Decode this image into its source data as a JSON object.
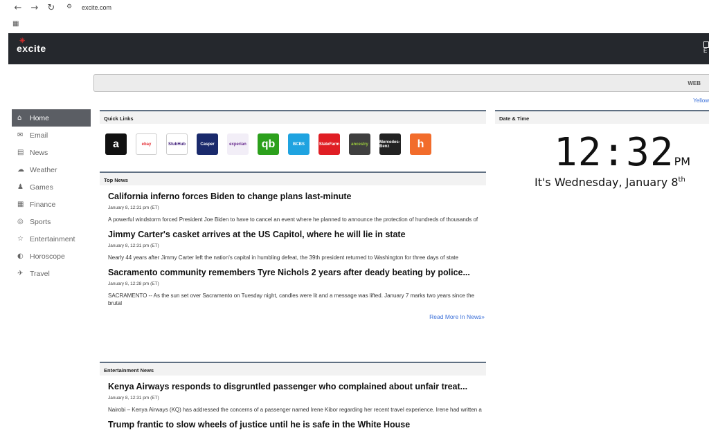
{
  "browser": {
    "url": "excite.com"
  },
  "header": {
    "logo_text": "excite",
    "right_label": "E"
  },
  "search": {
    "web_label": "WEB",
    "yellow_link": "Yellow"
  },
  "sidebar": {
    "items": [
      {
        "label": "Home",
        "icon": "home-icon",
        "glyph": "⌂",
        "active": true
      },
      {
        "label": "Email",
        "icon": "email-icon",
        "glyph": "✉",
        "active": false
      },
      {
        "label": "News",
        "icon": "news-icon",
        "glyph": "▤",
        "active": false
      },
      {
        "label": "Weather",
        "icon": "weather-icon",
        "glyph": "☁",
        "active": false
      },
      {
        "label": "Games",
        "icon": "games-icon",
        "glyph": "♟",
        "active": false
      },
      {
        "label": "Finance",
        "icon": "finance-icon",
        "glyph": "▦",
        "active": false
      },
      {
        "label": "Sports",
        "icon": "sports-icon",
        "glyph": "◎",
        "active": false
      },
      {
        "label": "Entertainment",
        "icon": "entertainment-icon",
        "glyph": "☆",
        "active": false
      },
      {
        "label": "Horoscope",
        "icon": "horoscope-icon",
        "glyph": "◐",
        "active": false
      },
      {
        "label": "Travel",
        "icon": "travel-icon",
        "glyph": "✈",
        "active": false
      }
    ]
  },
  "quick_links": {
    "title": "Quick Links",
    "logos": [
      {
        "name": "amazon",
        "text": "a",
        "bg": "#111111",
        "fg": "#ffffff"
      },
      {
        "name": "ebay",
        "text": "ebay",
        "bg": "#ffffff",
        "fg": "#e53238"
      },
      {
        "name": "stubhub",
        "text": "StubHub",
        "bg": "#ffffff",
        "fg": "#3d1a78"
      },
      {
        "name": "casper",
        "text": "Casper",
        "bg": "#1a2a6c",
        "fg": "#ffffff"
      },
      {
        "name": "experian",
        "text": "experian",
        "bg": "#f2eef7",
        "fg": "#6a2d8f"
      },
      {
        "name": "quickbooks",
        "text": "qb",
        "bg": "#2ca01c",
        "fg": "#ffffff"
      },
      {
        "name": "bluecross",
        "text": "BCBS",
        "bg": "#1fa3e0",
        "fg": "#ffffff"
      },
      {
        "name": "statefarm",
        "text": "StateFarm",
        "bg": "#e01e24",
        "fg": "#ffffff"
      },
      {
        "name": "ancestry",
        "text": "ancestry",
        "bg": "#3f3f3f",
        "fg": "#9ccc3c"
      },
      {
        "name": "mercedes",
        "text": "Mercedes-Benz",
        "bg": "#222222",
        "fg": "#ffffff"
      },
      {
        "name": "honey",
        "text": "h",
        "bg": "#f26c2b",
        "fg": "#ffffff"
      }
    ]
  },
  "top_news": {
    "title": "Top News",
    "articles": [
      {
        "headline": "California inferno forces Biden to change plans last-minute",
        "date": "January 8, 12:31 pm (ET)",
        "summary": "A powerful windstorm forced President Joe Biden to have to cancel an event where he planned to announce the protection of hundreds of thousands of"
      },
      {
        "headline": "Jimmy Carter's casket arrives at the US Capitol, where he will lie in state",
        "date": "January 8, 12:31 pm (ET)",
        "summary": "Nearly 44 years after Jimmy Carter left the nation's capital in humbling defeat, the 39th president returned to Washington for three days of state"
      },
      {
        "headline": "Sacramento community remembers Tyre Nichols 2 years after deady beating by police...",
        "date": "January 8, 12:28 pm (ET)",
        "summary": "SACRAMENTO -- As the sun set over Sacramento on Tuesday night, candles were lit and a message was lifted.  January 7 marks two years since the brutal"
      }
    ],
    "read_more": "Read More In News"
  },
  "entertainment_news": {
    "title": "Entertainment News",
    "articles": [
      {
        "headline": "Kenya Airways responds to disgruntled passenger who complained about unfair treat...",
        "date": "January 8, 12:31 pm (ET)",
        "summary": "Nairobi – Kenya Airways (KQ) has addressed the concerns of a passenger named Irene Kibor regarding her recent travel experience. Irene had written a"
      },
      {
        "headline": "Trump frantic to slow wheels of justice until he is safe in the White House",
        "date": "",
        "summary": ""
      }
    ]
  },
  "datetime": {
    "title": "Date & Time",
    "time": "12:32",
    "ampm": "PM",
    "date_text": "It's Wednesday, January 8",
    "date_suffix": "th"
  }
}
